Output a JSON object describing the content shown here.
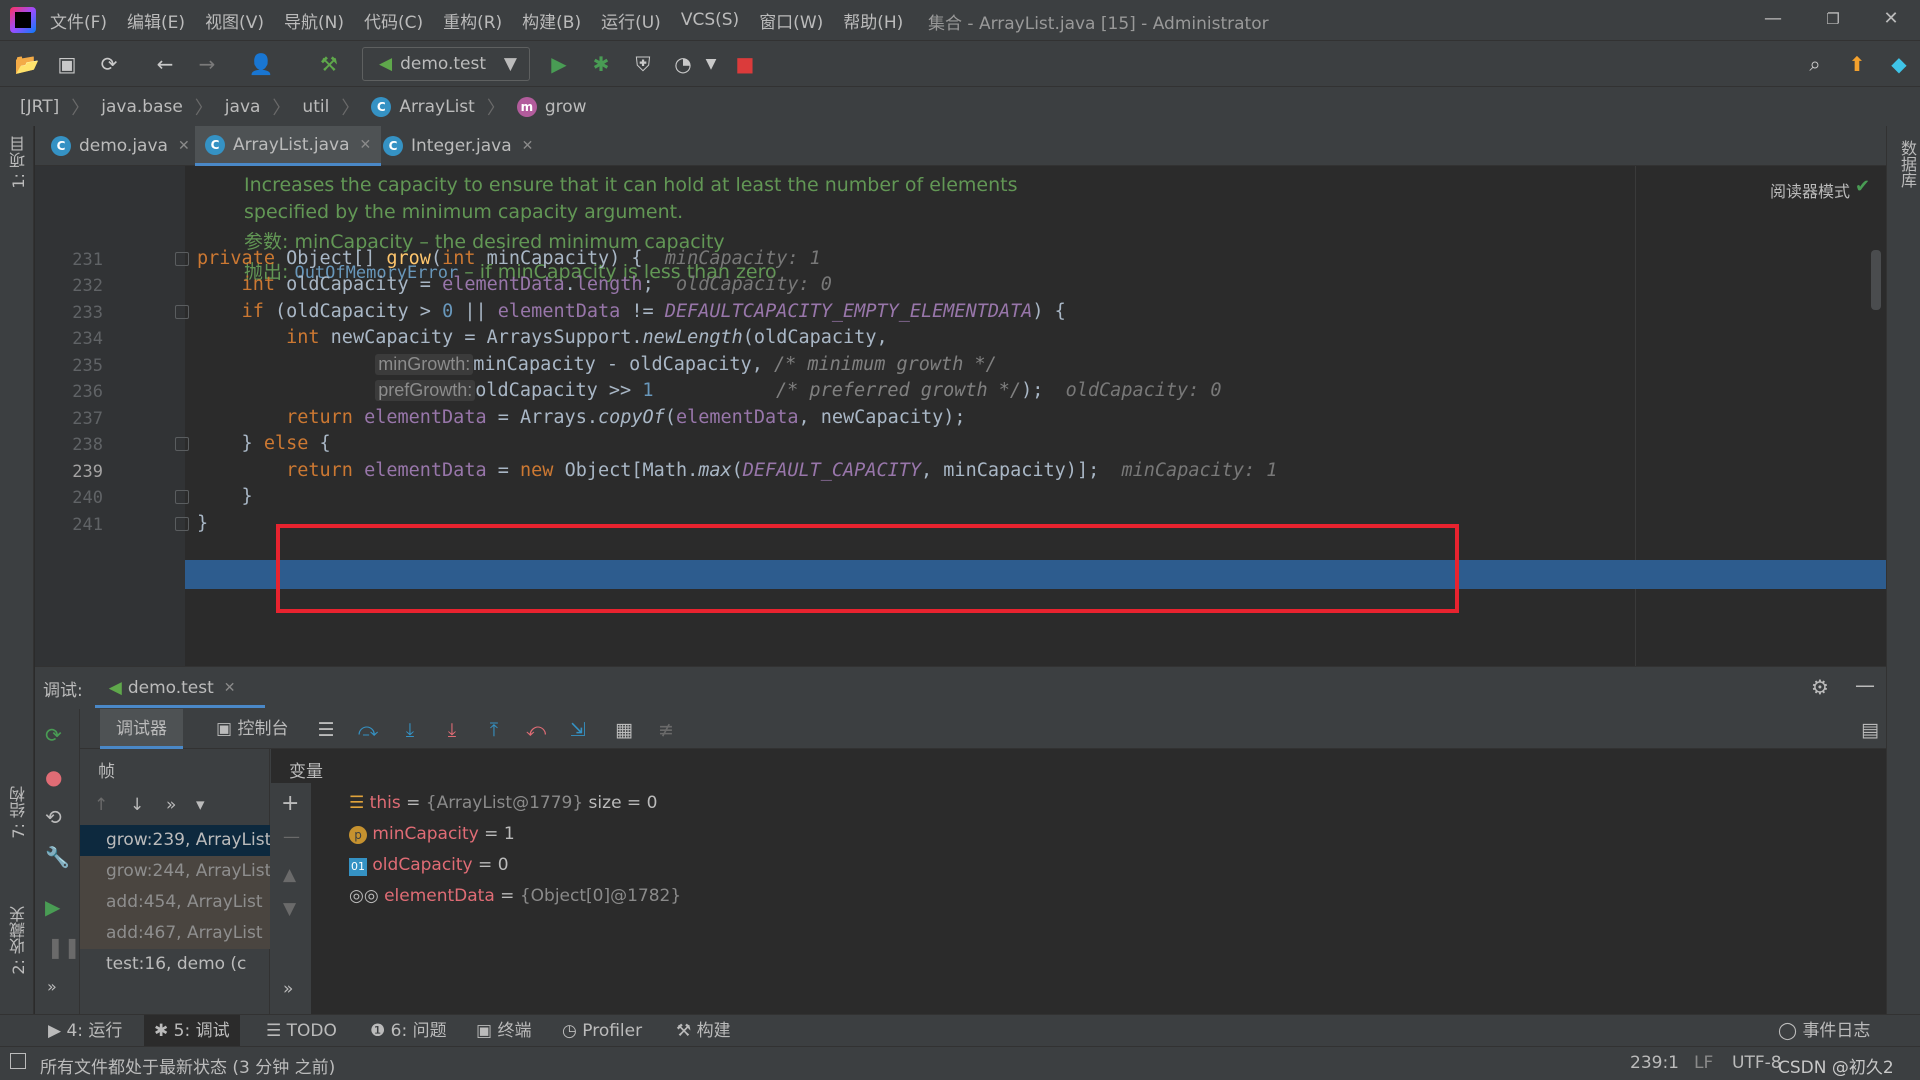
{
  "window": {
    "title": "集合 - ArrayList.java [15] - Administrator",
    "menu": [
      "文件(F)",
      "编辑(E)",
      "视图(V)",
      "导航(N)",
      "代码(C)",
      "重构(R)",
      "构建(B)",
      "运行(U)",
      "VCS(S)",
      "窗口(W)",
      "帮助(H)"
    ]
  },
  "toolbar": {
    "run_config": "demo.test"
  },
  "breadcrumb": [
    "[JRT]",
    "java.base",
    "java",
    "util",
    "ArrayList",
    "grow"
  ],
  "tabs": [
    {
      "label": "demo.java",
      "active": false
    },
    {
      "label": "ArrayList.java",
      "active": true
    },
    {
      "label": "Integer.java",
      "active": false
    }
  ],
  "left_stripe": {
    "project": "1: 项目",
    "structure": "7: 结构",
    "favorites": "2: 收藏夹"
  },
  "right_stripe": {
    "database": "数据库"
  },
  "editor": {
    "reader_mode": "阅读器模式",
    "doc": {
      "line1": "Increases the capacity to ensure that it can hold at least the number of elements",
      "line2": "specified by the minimum capacity argument.",
      "param_label": "参数:",
      "param_text": "minCapacity – the desired minimum capacity",
      "throws_label": "抛出:",
      "throws_type": "OutOfMemoryError",
      "throws_text": " – if minCapacity is less than zero"
    },
    "line_numbers": [
      "231",
      "232",
      "233",
      "234",
      "235",
      "236",
      "237",
      "238",
      "239",
      "240",
      "241"
    ],
    "inline": {
      "l231": "minCapacity: 1",
      "l232": "oldCapacity: 0",
      "l236": "oldCapacity: 0",
      "l239": "minCapacity: 1"
    },
    "hints": {
      "minGrowth": "minGrowth:",
      "prefGrowth": "prefGrowth:"
    }
  },
  "debug": {
    "label": "调试:",
    "session": "demo.test",
    "tabs": {
      "debugger": "调试器",
      "console": "控制台"
    },
    "frames_header": "帧",
    "vars_header": "变量",
    "frames": [
      "grow:239, ArrayList",
      "grow:244, ArrayList",
      "add:454, ArrayList",
      "add:467, ArrayList",
      "test:16, demo (c"
    ],
    "variables": [
      {
        "name": "this",
        "eq": " = ",
        "meta": "{ArrayList@1779}",
        "extra": "  size = 0",
        "icon": "list-icon"
      },
      {
        "name": "minCapacity",
        "eq": " = ",
        "meta": "",
        "extra": "1",
        "icon": "param-icon"
      },
      {
        "name": "oldCapacity",
        "eq": " = ",
        "meta": "",
        "extra": "0",
        "icon": "local-icon"
      },
      {
        "name": "elementData",
        "eq": " = ",
        "meta": "{Object[0]@1782}",
        "extra": "",
        "icon": "watch-icon"
      }
    ]
  },
  "bottombar": {
    "run": "4: 运行",
    "debug": "5: 调试",
    "todo": "TODO",
    "problems": "6: 问题",
    "terminal": "终端",
    "profiler": "Profiler",
    "build": "构建",
    "event_log": "事件日志"
  },
  "status": {
    "message": "所有文件都处于最新状态 (3 分钟 之前)",
    "position": "239:1",
    "line_sep": "LF",
    "encoding": "UTF-8",
    "watermark": "CSDN @初久2"
  }
}
